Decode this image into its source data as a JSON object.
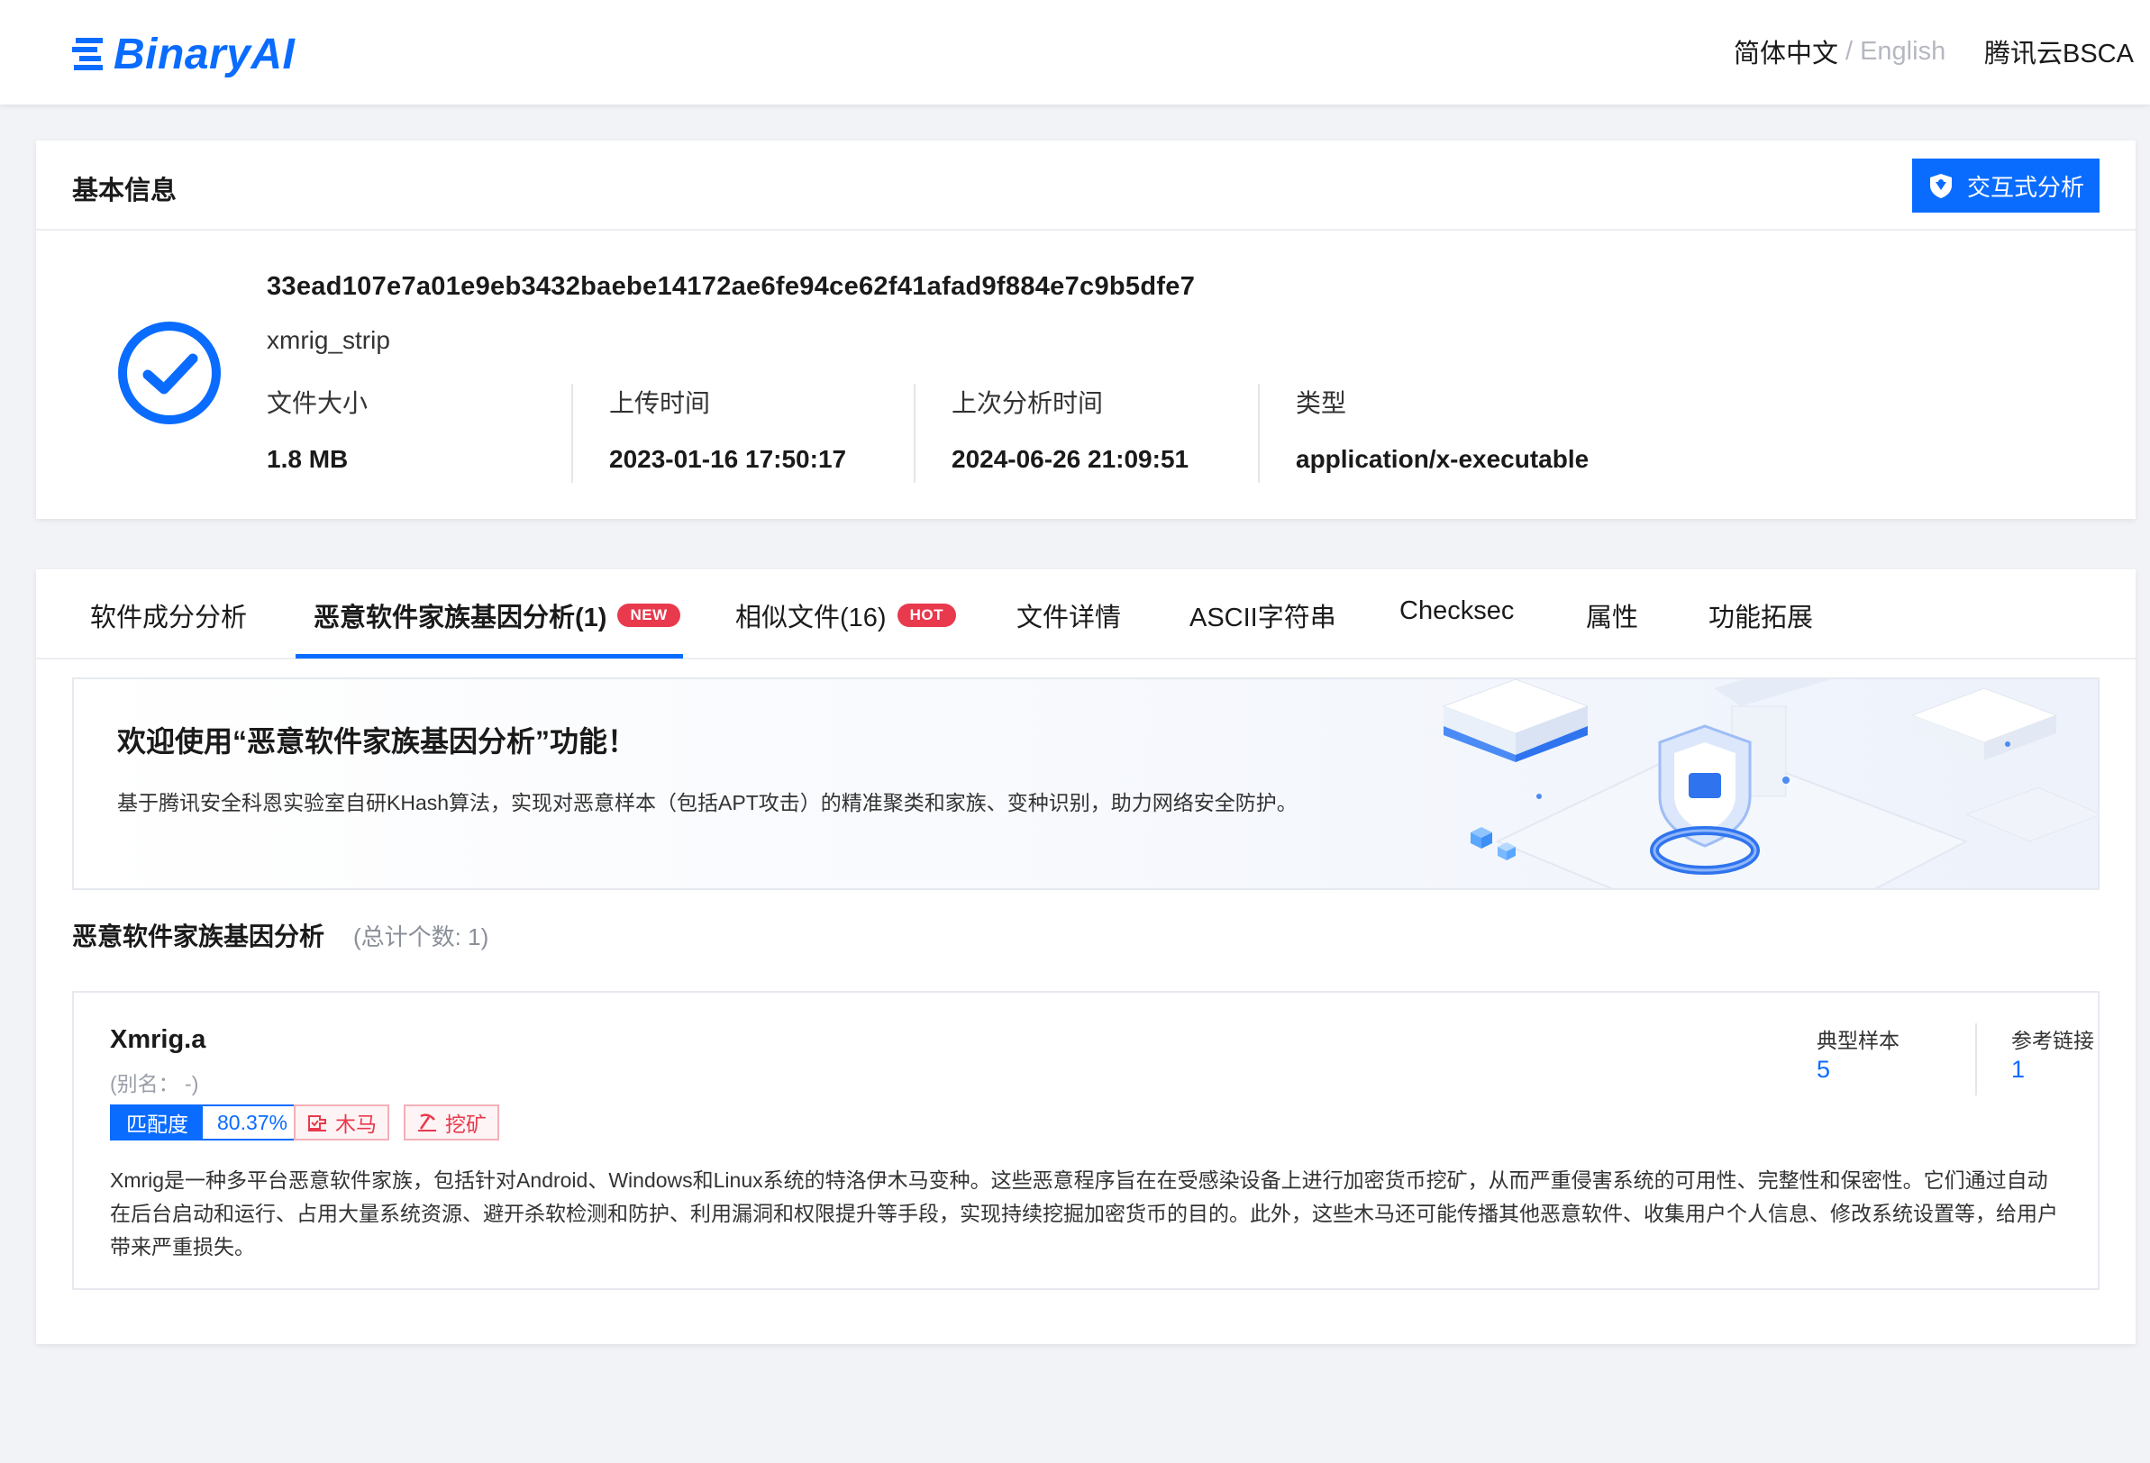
{
  "header": {
    "logo_text": "BinaryAI",
    "lang_cn": "简体中文",
    "lang_sep": "/",
    "lang_en": "English",
    "bsca": "腾讯云BSCA"
  },
  "basic_info": {
    "title": "基本信息",
    "analyze_button": "交互式分析",
    "hash": "33ead107e7a01e9eb3432baebe14172ae6fe94ce62f41afad9f884e7c9b5dfe7",
    "filename": "xmrig_strip",
    "meta": [
      {
        "label": "文件大小",
        "value": "1.8 MB"
      },
      {
        "label": "上传时间",
        "value": "2023-01-16 17:50:17"
      },
      {
        "label": "上次分析时间",
        "value": "2024-06-26 21:09:51"
      },
      {
        "label": "类型",
        "value": "application/x-executable"
      }
    ]
  },
  "tabs": [
    {
      "label": "软件成分分析"
    },
    {
      "label": "恶意软件家族基因分析(1)",
      "badge": "NEW",
      "active": true
    },
    {
      "label": "相似文件(16)",
      "badge": "HOT"
    },
    {
      "label": "文件详情"
    },
    {
      "label": "ASCII字符串"
    },
    {
      "label": "Checksec"
    },
    {
      "label": "属性"
    },
    {
      "label": "功能拓展"
    }
  ],
  "banner": {
    "title": "欢迎使用“恶意软件家族基因分析”功能！",
    "desc": "基于腾讯安全科恩实验室自研KHash算法，实现对恶意样本（包括APT攻击）的精准聚类和家族、变种识别，助力网络安全防护。"
  },
  "section": {
    "title": "恶意软件家族基因分析",
    "count": "(总计个数: 1)"
  },
  "family": {
    "name": "Xmrig.a",
    "alias": "(别名：  -)",
    "match_label": "匹配度",
    "match_value": "80.37%",
    "tags": [
      "木马",
      "挖矿"
    ],
    "stats": [
      {
        "label": "典型样本",
        "value": "5"
      },
      {
        "label": "参考链接",
        "value": "1"
      }
    ],
    "description": "Xmrig是一种多平台恶意软件家族，包括针对Android、Windows和Linux系统的特洛伊木马变种。这些恶意程序旨在在受感染设备上进行加密货币挖矿，从而严重侵害系统的可用性、完整性和保密性。它们通过自动在后台启动和运行、占用大量系统资源、避开杀软检测和防护、利用漏洞和权限提升等手段，实现持续挖掘加密货币的目的。此外，这些木马还可能传播其他恶意软件、收集用户个人信息、修改系统设置等，给用户带来严重损失。"
  },
  "colors": {
    "brand": "#0a6cff",
    "danger": "#e8394d",
    "background": "#f2f3f7"
  }
}
